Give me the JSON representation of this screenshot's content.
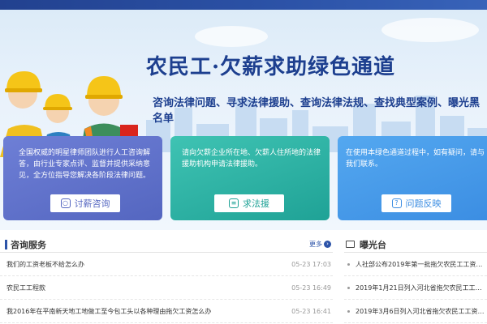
{
  "hero": {
    "title": "农民工·欠薪求助绿色通道",
    "subtitle": "咨询法律问题、寻求法律援助、查询法律法规、查找典型案例、曝光黑名单"
  },
  "cards": [
    {
      "text": "全国权威的明星律师团队进行人工咨询解答，由行业专家点评、监督并提供采纳意见，全方位指导您解决各阶段法律问题。",
      "button": "讨薪咨询",
      "color": "#5466c0"
    },
    {
      "text": "请向欠薪企业所在地、欠薪人住所地的法律援助机构申请法律援助。",
      "button": "求法援",
      "color": "#1fa296"
    },
    {
      "text": "在使用本绿色通道过程中，如有疑问，请与我们联系。",
      "button": "问题反映",
      "color": "#3b8de2"
    }
  ],
  "consult": {
    "title": "咨询服务",
    "more": "更多",
    "rows": [
      {
        "text": "我们的工资老板不给怎么办",
        "date": "05-23 17:03"
      },
      {
        "text": "农民工工程款",
        "date": "05-23 16:49"
      },
      {
        "text": "我2016年在平南新天地工地做工至今包工头以各种理由拖欠工资怎么办",
        "date": "05-23 16:41"
      }
    ]
  },
  "exposure": {
    "title": "曝光台",
    "rows": [
      {
        "text": "人社部公布2019年第一批拖欠农民工工资…"
      },
      {
        "text": "2019年1月21日列入河北省拖欠农民工工…"
      },
      {
        "text": "2019年3月6日列入河北省拖欠农民工工资…"
      }
    ]
  }
}
